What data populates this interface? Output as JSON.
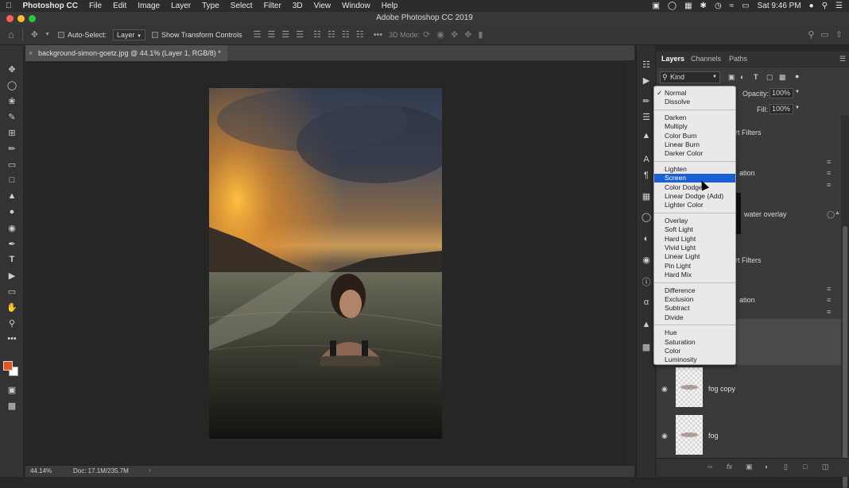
{
  "menubar": {
    "app": "Photoshop CC",
    "items": [
      "File",
      "Edit",
      "Image",
      "Layer",
      "Type",
      "Select",
      "Filter",
      "3D",
      "View",
      "Window",
      "Help"
    ],
    "clock": "Sat 9:46 PM"
  },
  "window": {
    "title": "Adobe Photoshop CC 2019"
  },
  "options": {
    "auto_select_label": "Auto-Select:",
    "layer_select": "Layer",
    "show_transform_label": "Show Transform Controls",
    "mode_3d_label": "3D Mode:"
  },
  "document": {
    "tab_title": "background-simon-goetz.jpg @ 44.1% (Layer 1, RGB/8) *"
  },
  "status": {
    "zoom": "44.14%",
    "doc": "Doc: 17.1M/235.7M"
  },
  "layers_panel": {
    "tabs": [
      "Layers",
      "Channels",
      "Paths"
    ],
    "filter_kind": "Kind",
    "opacity_label": "Opacity:",
    "opacity_value": "100%",
    "fill_label": "Fill:",
    "fill_value": "100%",
    "partial": {
      "smart_filters_1": "art Filters",
      "row_a": "ation",
      "water": "water overlay",
      "smart_filters_2": "art Filters",
      "row_b": "ation"
    },
    "layers": [
      {
        "name": "fog copy"
      },
      {
        "name": "fog"
      }
    ]
  },
  "blend_menu": {
    "groups": [
      [
        "Normal",
        "Dissolve"
      ],
      [
        "Darken",
        "Multiply",
        "Color Burn",
        "Linear Burn",
        "Darker Color"
      ],
      [
        "Lighten",
        "Screen",
        "Color Dodge",
        "Linear Dodge (Add)",
        "Lighter Color"
      ],
      [
        "Overlay",
        "Soft Light",
        "Hard Light",
        "Vivid Light",
        "Linear Light",
        "Pin Light",
        "Hard Mix"
      ],
      [
        "Difference",
        "Exclusion",
        "Subtract",
        "Divide"
      ],
      [
        "Hue",
        "Saturation",
        "Color",
        "Luminosity"
      ]
    ],
    "checked": "Normal",
    "highlighted": "Screen"
  },
  "colors": {
    "foreground": "#e8531c",
    "background": "#ffffff",
    "highlight": "#1a5fd3"
  }
}
